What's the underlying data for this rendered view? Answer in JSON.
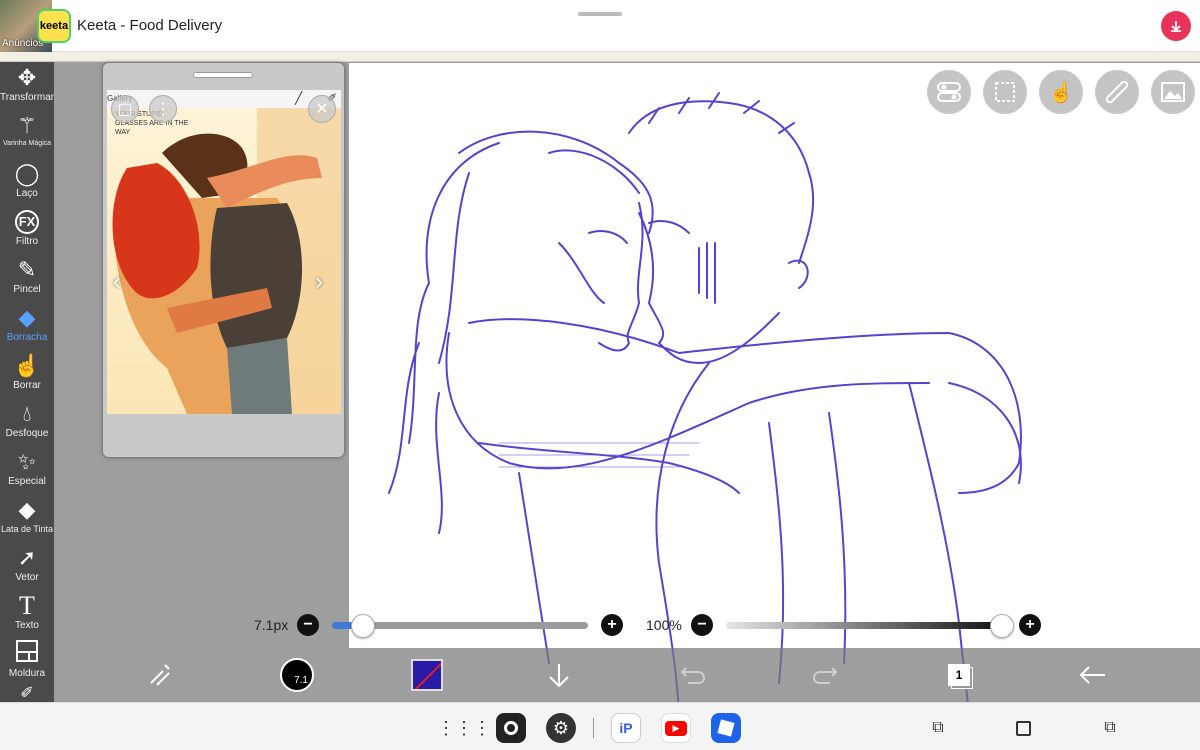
{
  "ad": {
    "label": "Anúncios",
    "logo_text": "keeta",
    "title": "Keeta - Food Delivery",
    "download_icon": "download-arrow-icon"
  },
  "toolbar": {
    "items": [
      {
        "label": "Transformar",
        "icon": "move-arrows-icon"
      },
      {
        "label": "Varinha Mágica",
        "icon": "magic-wand-icon"
      },
      {
        "label": "Laço",
        "icon": "lasso-icon"
      },
      {
        "label": "Filtro",
        "icon": "fx-icon"
      },
      {
        "label": "Pincel",
        "icon": "brush-icon"
      },
      {
        "label": "Borracha",
        "icon": "eraser-icon",
        "active": true
      },
      {
        "label": "Borrar",
        "icon": "smudge-icon"
      },
      {
        "label": "Desfoque",
        "icon": "blur-drop-icon"
      },
      {
        "label": "Especial",
        "icon": "special-sparkle-icon"
      },
      {
        "label": "Lata de Tinta",
        "icon": "paint-bucket-icon"
      },
      {
        "label": "Vetor",
        "icon": "cursor-arrow-icon"
      },
      {
        "label": "Texto",
        "icon": "text-t-icon"
      },
      {
        "label": "Moldura",
        "icon": "frame-icon"
      }
    ]
  },
  "reference": {
    "bar_text": "Gallery",
    "speech_text": "YOUR STUPID GLASSES ARE IN THE WAY"
  },
  "brush": {
    "size_label": "7.1px",
    "size_value": 0.12,
    "preview_text": "7.1"
  },
  "zoom": {
    "label": "100%",
    "opacity_value": 1.0
  },
  "colors": {
    "current_color": "#2a1aa8",
    "accent": "#3e7bd6",
    "sketch": "#3a22c8"
  }
}
